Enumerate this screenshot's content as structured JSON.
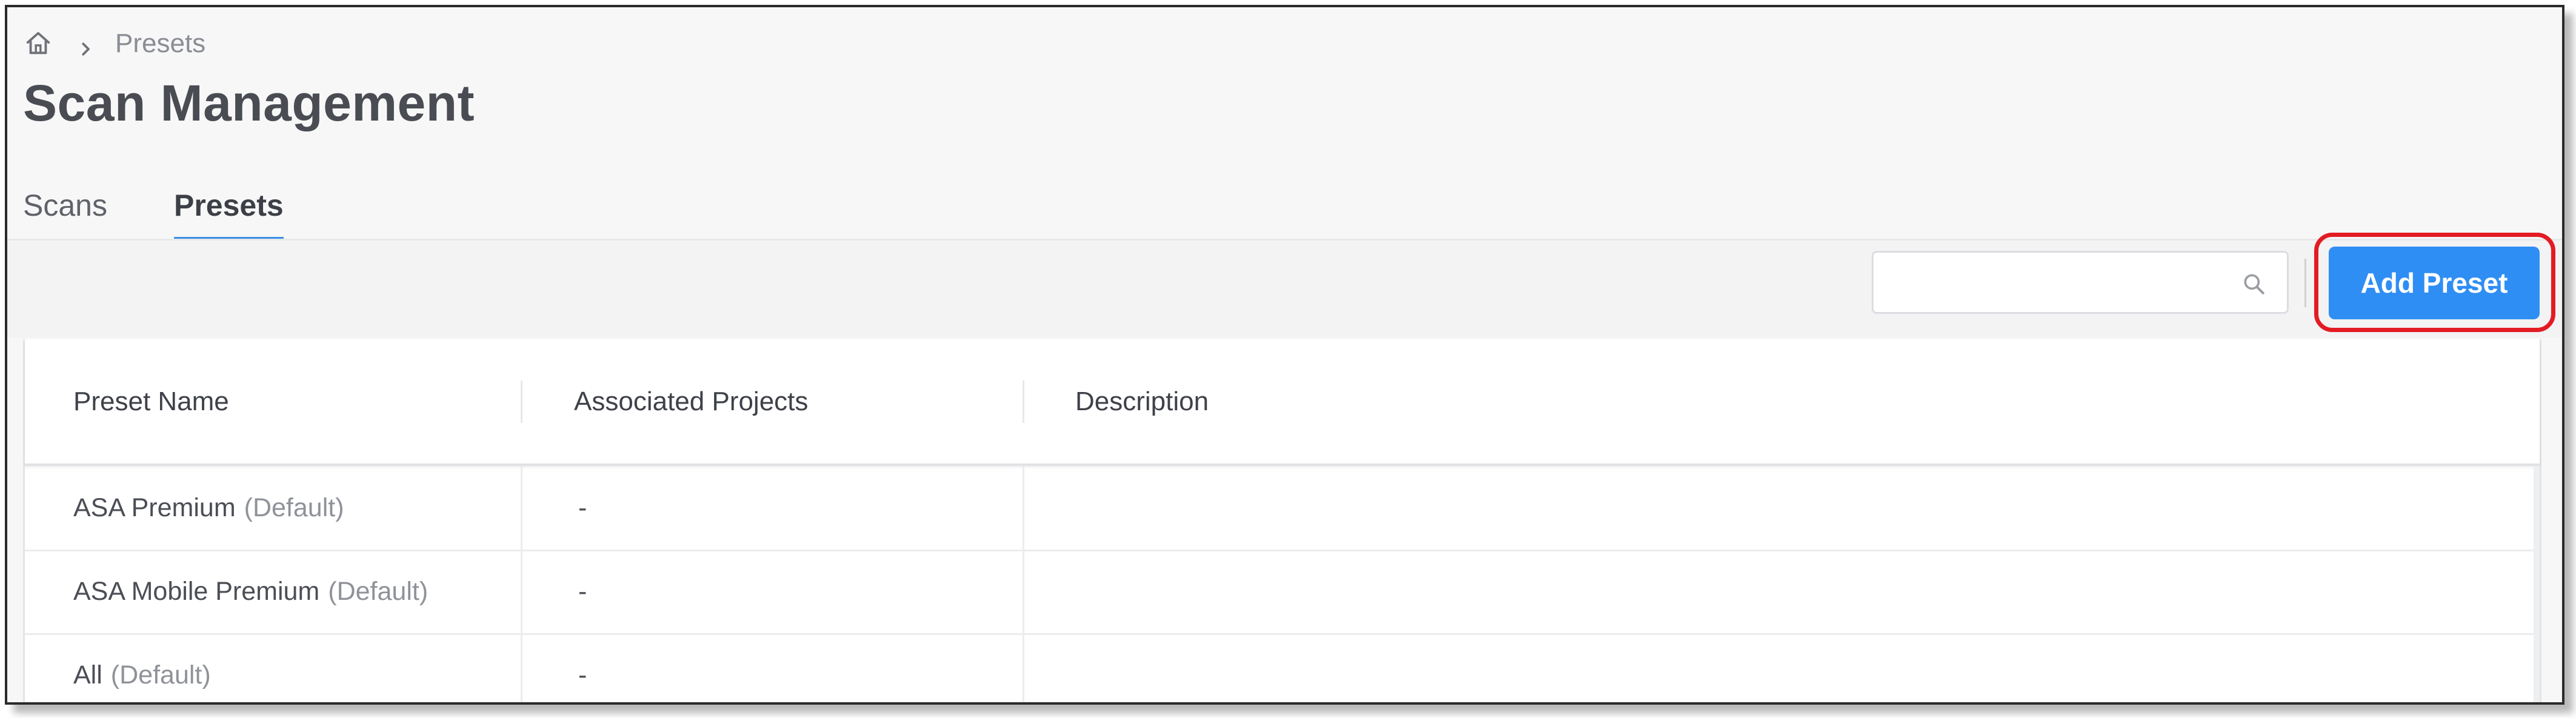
{
  "breadcrumb": {
    "home_icon": "home-icon",
    "separator_icon": "chevron-right-icon",
    "current": "Presets"
  },
  "page": {
    "title": "Scan Management"
  },
  "tabs": [
    {
      "label": "Scans",
      "active": false
    },
    {
      "label": "Presets",
      "active": true
    }
  ],
  "toolbar": {
    "search_value": "",
    "search_placeholder": "",
    "search_icon": "search-icon",
    "add_label": "Add Preset",
    "accent_color": "#2f8ef4",
    "highlight_color": "#e31b23"
  },
  "table": {
    "columns": [
      "Preset Name",
      "Associated Projects",
      "Description"
    ],
    "rows": [
      {
        "name": "ASA Premium",
        "tag": "(Default)",
        "projects": "-",
        "description": ""
      },
      {
        "name": "ASA Mobile Premium",
        "tag": "(Default)",
        "projects": "-",
        "description": ""
      },
      {
        "name": "All",
        "tag": "(Default)",
        "projects": "-",
        "description": ""
      }
    ]
  }
}
